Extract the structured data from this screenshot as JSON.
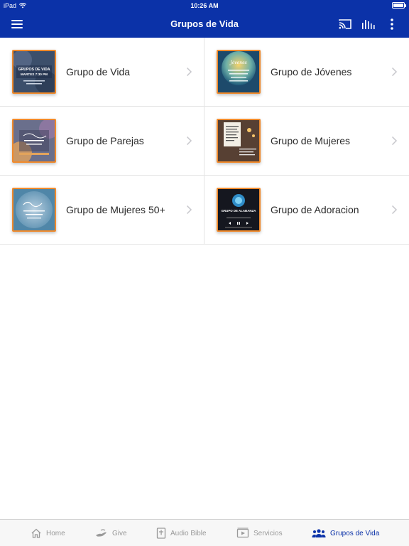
{
  "status": {
    "device": "iPad",
    "time": "10:26 AM"
  },
  "navbar": {
    "title": "Grupos de Vida"
  },
  "groups": [
    {
      "label": "Grupo de Vida",
      "thumb_caption": "GRUPOS DE VIDA",
      "thumb_sub": "MARTES 7:30 PM"
    },
    {
      "label": "Grupo de Jóvenes",
      "thumb_caption": "Jóvenes",
      "thumb_sub": ""
    },
    {
      "label": "Grupo de Parejas",
      "thumb_caption": "",
      "thumb_sub": ""
    },
    {
      "label": "Grupo de Mujeres",
      "thumb_caption": "",
      "thumb_sub": ""
    },
    {
      "label": "Grupo de Mujeres 50+",
      "thumb_caption": "",
      "thumb_sub": ""
    },
    {
      "label": "Grupo de Adoracion",
      "thumb_caption": "GRUPO DE ALABANZA",
      "thumb_sub": ""
    }
  ],
  "tabs": [
    {
      "label": "Home",
      "icon": "home-icon"
    },
    {
      "label": "Give",
      "icon": "give-hand-icon"
    },
    {
      "label": "Audio Bible",
      "icon": "bible-icon"
    },
    {
      "label": "Servicios",
      "icon": "video-play-icon"
    },
    {
      "label": "Grupos de Vida",
      "icon": "group-people-icon",
      "active": true
    }
  ],
  "colors": {
    "brand": "#0b32a8",
    "thumb_border": "#f08a2c",
    "inactive_tab": "#9a9a9a"
  }
}
